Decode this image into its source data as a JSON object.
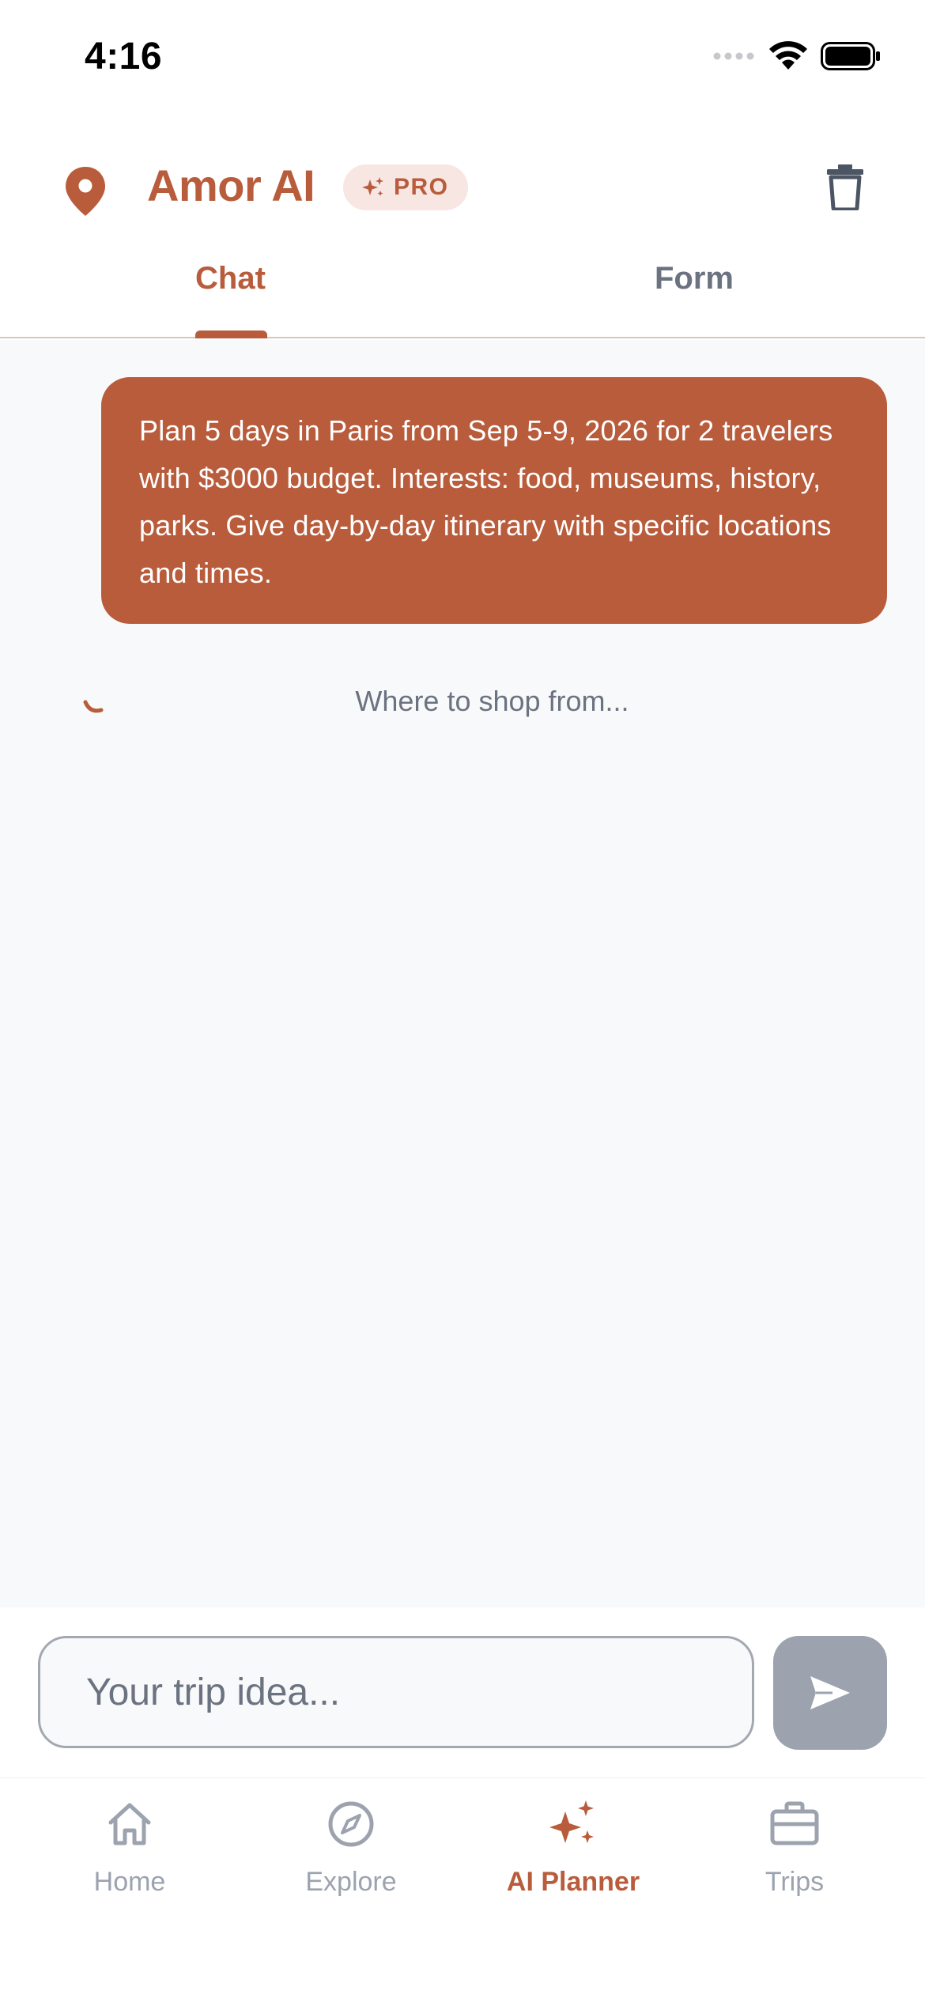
{
  "status_bar": {
    "time": "4:16"
  },
  "header": {
    "app_title": "Amor AI",
    "pro_badge": "PRO"
  },
  "tabs": [
    {
      "label": "Chat",
      "active": true
    },
    {
      "label": "Form",
      "active": false
    }
  ],
  "chat": {
    "user_message": "Plan 5 days in Paris from Sep 5-9, 2026 for 2 travelers with $3000 budget. Interests: food, museums, history, parks. Give day-by-day itinerary with specific locations and times.",
    "loading_text": "Where to shop from..."
  },
  "input": {
    "placeholder": "Your trip idea...",
    "value": ""
  },
  "bottom_nav": [
    {
      "label": "Home",
      "icon": "home-icon",
      "active": false
    },
    {
      "label": "Explore",
      "icon": "compass-icon",
      "active": false
    },
    {
      "label": "AI Planner",
      "icon": "sparkles-icon",
      "active": true
    },
    {
      "label": "Trips",
      "icon": "briefcase-icon",
      "active": false
    }
  ],
  "colors": {
    "accent": "#b85c3c",
    "badge_bg": "#f7e6e2",
    "chat_bg": "#f8f9fb",
    "inactive": "#9ca3af",
    "send_button": "#9ca3af"
  }
}
